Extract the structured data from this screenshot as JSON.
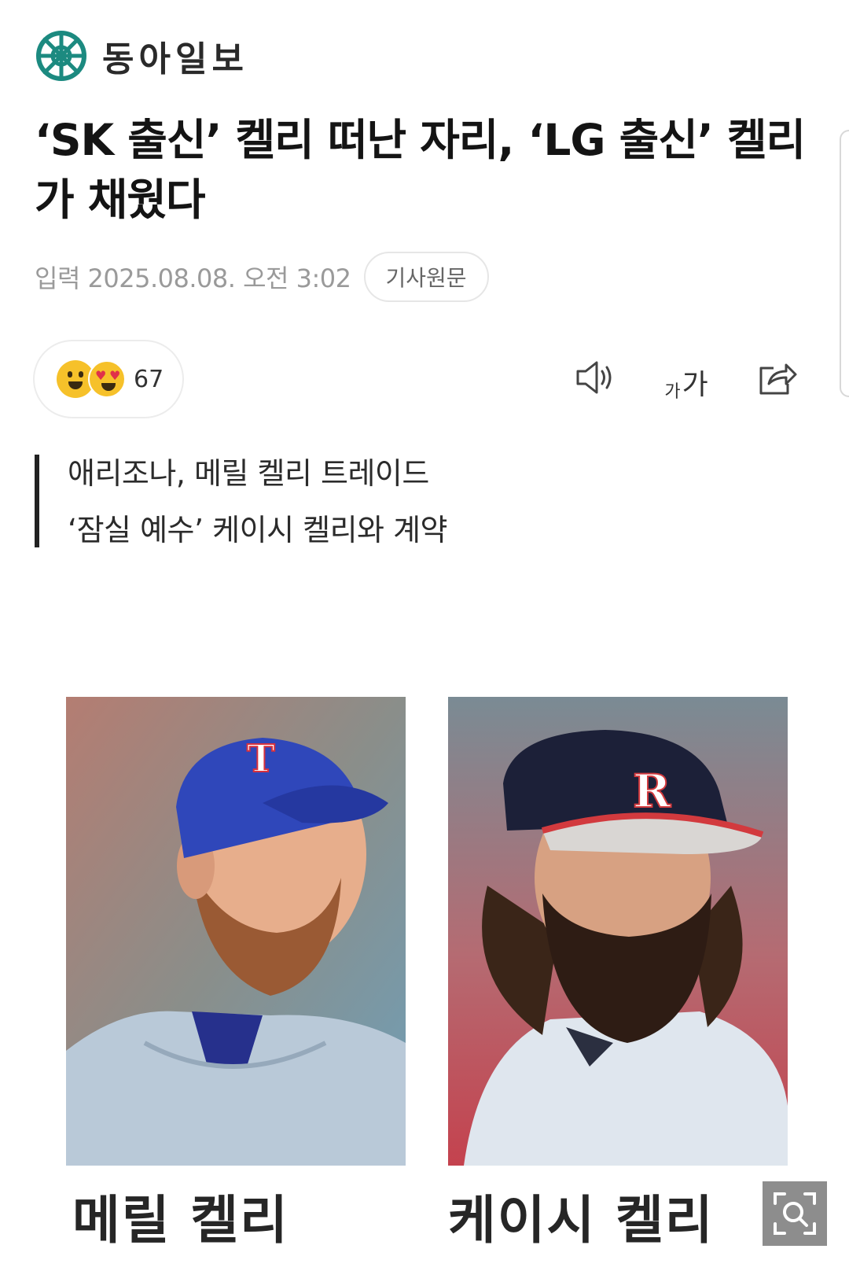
{
  "header": {
    "logo_text": "동아일보",
    "logo_icon": "dongailbo-emblem-icon",
    "brand_color": "#1c8a80"
  },
  "article": {
    "headline": "‘SK 출신’ 켈리 떠난 자리, ‘LG 출신’ 켈리가 채웠다",
    "date": "입력 2025.08.08. 오전 3:02",
    "source_button": "기사원문"
  },
  "reactions": {
    "count": "67",
    "icons": [
      "grinning-face-icon",
      "heart-eyes-face-icon"
    ]
  },
  "tools": [
    "speaker-icon",
    "font-size-icon",
    "share-icon"
  ],
  "fontsize_label": {
    "small": "가",
    "large": "가"
  },
  "summary": [
    "애리조나, 메릴 켈리 트레이드",
    "‘잠실 예수’ 케이시 켈리와 계약"
  ],
  "photos": [
    {
      "caption": "메릴 켈리",
      "cap_logo": "T"
    },
    {
      "caption": "케이시 켈리",
      "cap_logo": "R"
    }
  ],
  "zoom_icon": "zoom-in-icon"
}
